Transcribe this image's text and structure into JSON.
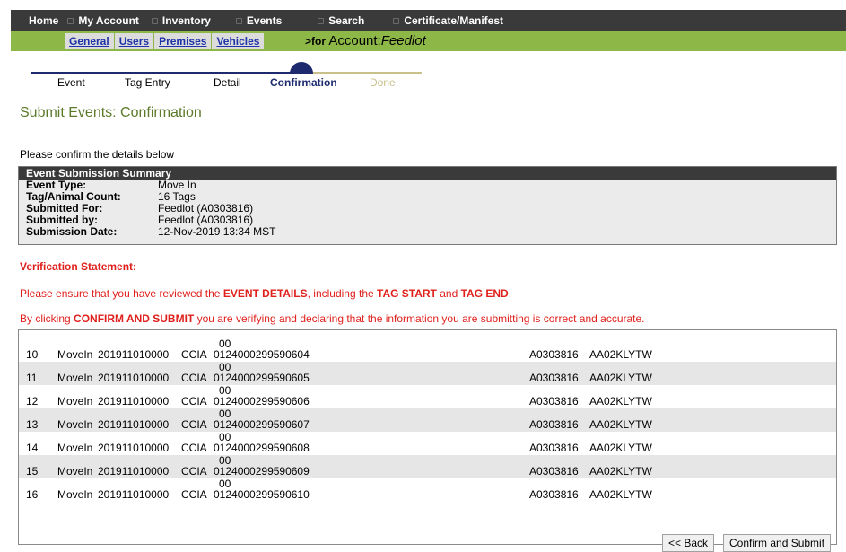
{
  "topnav": {
    "items": [
      "Home",
      "My Account",
      "Inventory",
      "Events",
      "Search",
      "Certificate/Manifest"
    ]
  },
  "subnav": {
    "links": [
      "General",
      "Users",
      "Premises",
      "Vehicles"
    ],
    "for_label": ">for",
    "account_label": "Account:",
    "account_name": "Feedlot"
  },
  "steps": {
    "items": [
      "Event",
      "Tag Entry",
      "Detail",
      "Confirmation",
      "Done"
    ],
    "current": "Confirmation"
  },
  "page_title": "Submit Events: Confirmation",
  "intro": "Please confirm the details below",
  "summary": {
    "title": "Event Submission Summary",
    "rows": [
      {
        "label": "Event Type:",
        "value": "Move In"
      },
      {
        "label": "Tag/Animal Count:",
        "value": "16 Tags"
      },
      {
        "label": "Submitted For:",
        "value": "Feedlot (A0303816)"
      },
      {
        "label": "Submitted by:",
        "value": "Feedlot (A0303816)"
      },
      {
        "label": "Submission Date:",
        "value": "12-Nov-2019 13:34 MST"
      }
    ]
  },
  "verification": {
    "heading": "Verification Statement:",
    "line1_a": "Please ensure that you have reviewed the ",
    "line1_b": "EVENT DETAILS",
    "line1_c": ", including the ",
    "line1_d": "TAG START",
    "line1_e": " and ",
    "line1_f": "TAG END",
    "line1_g": ".",
    "line2_a": "By clicking ",
    "line2_b": "CONFIRM AND SUBMIT",
    "line2_c": " you are verifying and declaring that the information you are submitting is correct and accurate."
  },
  "table": {
    "rows": [
      {
        "num": "10",
        "type": "MoveIn",
        "date": "201911010000",
        "org": "CCIA",
        "tag_top": "00",
        "tag": "0124000299590604",
        "premises": "A0303816",
        "auth": "AA02KLYTW"
      },
      {
        "num": "11",
        "type": "MoveIn",
        "date": "201911010000",
        "org": "CCIA",
        "tag_top": "00",
        "tag": "0124000299590605",
        "premises": "A0303816",
        "auth": "AA02KLYTW"
      },
      {
        "num": "12",
        "type": "MoveIn",
        "date": "201911010000",
        "org": "CCIA",
        "tag_top": "00",
        "tag": "0124000299590606",
        "premises": "A0303816",
        "auth": "AA02KLYTW"
      },
      {
        "num": "13",
        "type": "MoveIn",
        "date": "201911010000",
        "org": "CCIA",
        "tag_top": "00",
        "tag": "0124000299590607",
        "premises": "A0303816",
        "auth": "AA02KLYTW"
      },
      {
        "num": "14",
        "type": "MoveIn",
        "date": "201911010000",
        "org": "CCIA",
        "tag_top": "00",
        "tag": "0124000299590608",
        "premises": "A0303816",
        "auth": "AA02KLYTW"
      },
      {
        "num": "15",
        "type": "MoveIn",
        "date": "201911010000",
        "org": "CCIA",
        "tag_top": "00",
        "tag": "0124000299590609",
        "premises": "A0303816",
        "auth": "AA02KLYTW"
      },
      {
        "num": "16",
        "type": "MoveIn",
        "date": "201911010000",
        "org": "CCIA",
        "tag_top": "00",
        "tag": "0124000299590610",
        "premises": "A0303816",
        "auth": "AA02KLYTW"
      }
    ]
  },
  "buttons": {
    "back": "<< Back",
    "confirm": "Confirm and Submit"
  },
  "colors": {
    "nav_bg": "#3a3a3a",
    "subnav_bg": "#8db848",
    "title_green": "#5c7a2a",
    "alert_red": "#e0201c",
    "step_done": "#1d2b6e",
    "step_future": "#c9c08a"
  }
}
